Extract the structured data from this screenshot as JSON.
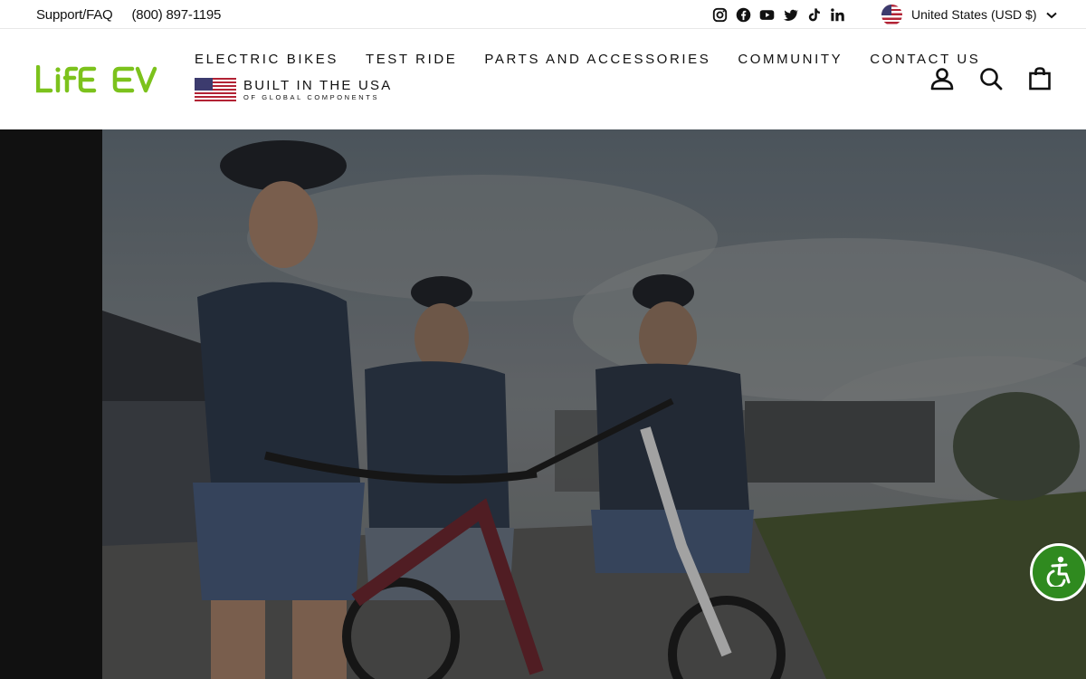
{
  "topbar": {
    "support_label": "Support/FAQ",
    "phone": "(800) 897-1195",
    "social_icons": [
      "instagram-icon",
      "facebook-icon",
      "youtube-icon",
      "twitter-icon",
      "tiktok-icon",
      "linkedin-icon"
    ],
    "currency_label": "United States (USD $)"
  },
  "header": {
    "logo_text": "LIFE EV",
    "brand_color": "#7cc21c",
    "nav": [
      "ELECTRIC BIKES",
      "TEST RIDE",
      "PARTS AND ACCESSORIES",
      "COMMUNITY",
      "CONTACT US"
    ],
    "usa_title": "BUILT IN THE USA",
    "usa_subtitle": "OF GLOBAL COMPONENTS",
    "icons": [
      "account-icon",
      "search-icon",
      "cart-icon"
    ]
  },
  "hero": {
    "image_alt": "",
    "overlay_color": "#000000"
  },
  "accessibility": {
    "button_color": "#2f8a1f"
  }
}
